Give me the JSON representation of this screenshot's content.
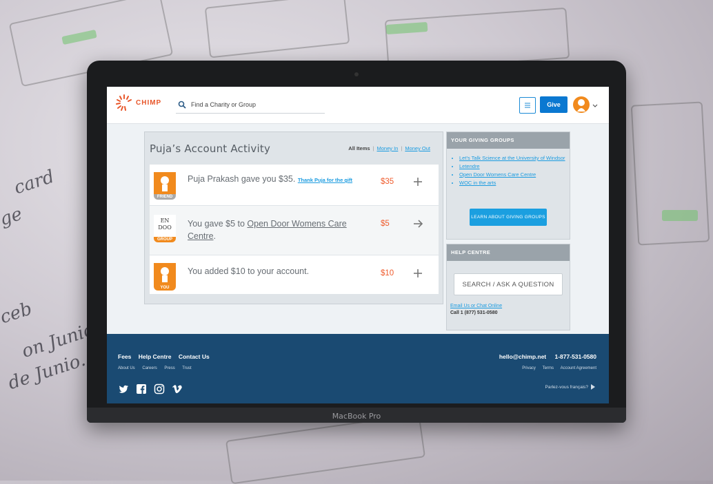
{
  "device": {
    "brand": "MacBook Pro"
  },
  "header": {
    "logo_text": "CHIMP",
    "search_placeholder": "Find a Charity or Group",
    "give_label": "Give",
    "accent": "#e8572b",
    "button_color": "#0a78d1"
  },
  "activity": {
    "title": "Puja’s Account Activity",
    "filters": {
      "all": "All Items",
      "money_in": "Money In",
      "money_out": "Money Out"
    },
    "rows": [
      {
        "text": "Puja Prakash gave you $35.",
        "link": "Thank Puja for the gift",
        "amount": "$35",
        "tag": "FRIEND",
        "icon": "plus-icon"
      },
      {
        "text_prefix": "You gave $5 to ",
        "link": "Open Door Womens Care Centre",
        "text_suffix": ".",
        "amount": "$5",
        "tag": "GROUP",
        "org_logo_text": "EN DOO",
        "icon": "arrow-right-icon"
      },
      {
        "text": "You added $10 to your account.",
        "amount": "$10",
        "tag": "YOU",
        "icon": "plus-icon"
      }
    ],
    "amount_color": "#ef5b2c"
  },
  "groups": {
    "heading": "YOUR GIVING GROUPS",
    "items": [
      "Let’s Talk Science at the University of Windsor",
      "Letendre",
      "Open Door Womens Care Centre",
      "WOC in the arts"
    ],
    "learn_button": "LEARN ABOUT GIVING GROUPS"
  },
  "help": {
    "heading": "HELP CENTRE",
    "search_button": "SEARCH / ASK A QUESTION",
    "email_link": "Email Us or Chat Online",
    "phone": "Call 1 (877) 531-0580"
  },
  "footer": {
    "main_links": [
      "Fees",
      "Help Centre",
      "Contact Us"
    ],
    "sub_links": [
      "About Us",
      "Careers",
      "Press",
      "Trust"
    ],
    "email": "hello@chimp.net",
    "phone": "1-877-531-0580",
    "legal_links": [
      "Privacy",
      "Terms",
      "Account Agreement"
    ],
    "language": "Parlez-vous français?",
    "social": [
      "twitter-icon",
      "facebook-icon",
      "instagram-icon",
      "vimeo-icon"
    ],
    "background": "#1a4a72"
  }
}
